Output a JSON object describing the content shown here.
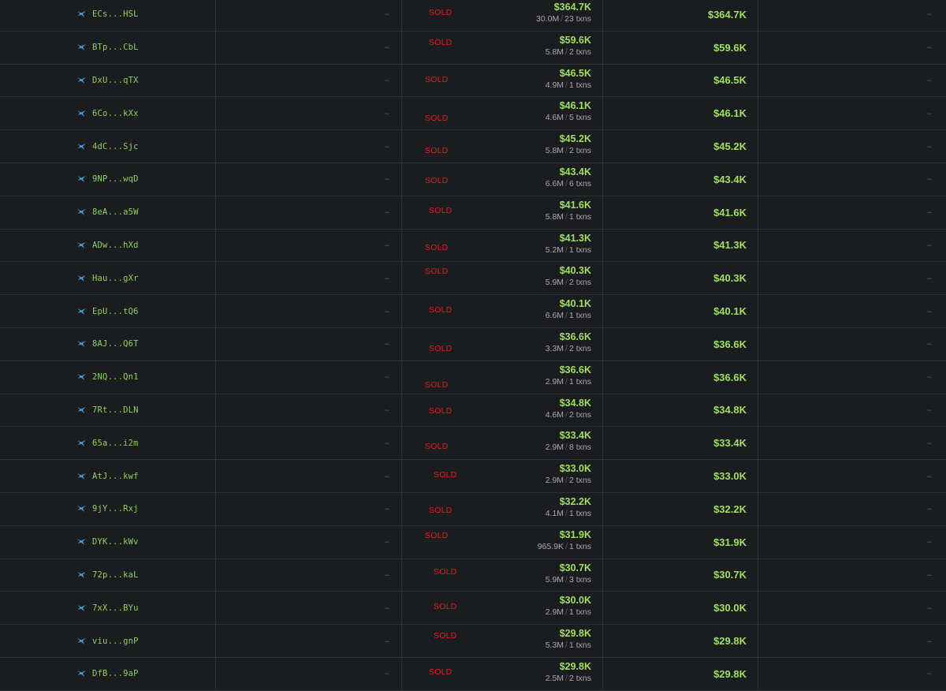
{
  "placeholder_dash": "–",
  "sold_label": "SOLD",
  "txns_suffix": "txns",
  "colors": {
    "background": "#1b1c20",
    "address": "#8dd25c",
    "usd_green": "#9fe061",
    "sold_red": "#e0211f",
    "muted": "#5b5c63",
    "whale_icon": "#4aa3df"
  },
  "rows": [
    {
      "maker": "ECs...HSL",
      "sold_usd": "$364.7K",
      "sold_tokens": "30.0M",
      "txns": "23",
      "pnl": "$364.7K"
    },
    {
      "maker": "BTp...CbL",
      "sold_usd": "$59.6K",
      "sold_tokens": "5.8M",
      "txns": "2",
      "pnl": "$59.6K"
    },
    {
      "maker": "DxU...qTX",
      "sold_usd": "$46.5K",
      "sold_tokens": "4.9M",
      "txns": "1",
      "pnl": "$46.5K"
    },
    {
      "maker": "6Co...kXx",
      "sold_usd": "$46.1K",
      "sold_tokens": "4.6M",
      "txns": "5",
      "pnl": "$46.1K"
    },
    {
      "maker": "4dC...Sjc",
      "sold_usd": "$45.2K",
      "sold_tokens": "5.8M",
      "txns": "2",
      "pnl": "$45.2K"
    },
    {
      "maker": "9NP...wqD",
      "sold_usd": "$43.4K",
      "sold_tokens": "6.6M",
      "txns": "6",
      "pnl": "$43.4K"
    },
    {
      "maker": "8eA...a5W",
      "sold_usd": "$41.6K",
      "sold_tokens": "5.8M",
      "txns": "1",
      "pnl": "$41.6K"
    },
    {
      "maker": "ADw...hXd",
      "sold_usd": "$41.3K",
      "sold_tokens": "5.2M",
      "txns": "1",
      "pnl": "$41.3K"
    },
    {
      "maker": "Hau...gXr",
      "sold_usd": "$40.3K",
      "sold_tokens": "5.9M",
      "txns": "2",
      "pnl": "$40.3K"
    },
    {
      "maker": "EpU...tQ6",
      "sold_usd": "$40.1K",
      "sold_tokens": "6.6M",
      "txns": "1",
      "pnl": "$40.1K"
    },
    {
      "maker": "8AJ...Q6T",
      "sold_usd": "$36.6K",
      "sold_tokens": "3.3M",
      "txns": "2",
      "pnl": "$36.6K"
    },
    {
      "maker": "2NQ...Qn1",
      "sold_usd": "$36.6K",
      "sold_tokens": "2.9M",
      "txns": "1",
      "pnl": "$36.6K"
    },
    {
      "maker": "7Rt...DLN",
      "sold_usd": "$34.8K",
      "sold_tokens": "4.6M",
      "txns": "2",
      "pnl": "$34.8K"
    },
    {
      "maker": "65a...i2m",
      "sold_usd": "$33.4K",
      "sold_tokens": "2.9M",
      "txns": "8",
      "pnl": "$33.4K"
    },
    {
      "maker": "AtJ...kwf",
      "sold_usd": "$33.0K",
      "sold_tokens": "2.9M",
      "txns": "2",
      "pnl": "$33.0K"
    },
    {
      "maker": "9jY...Rxj",
      "sold_usd": "$32.2K",
      "sold_tokens": "4.1M",
      "txns": "1",
      "pnl": "$32.2K"
    },
    {
      "maker": "DYK...kWv",
      "sold_usd": "$31.9K",
      "sold_tokens": "965.9K",
      "txns": "1",
      "pnl": "$31.9K"
    },
    {
      "maker": "72p...kaL",
      "sold_usd": "$30.7K",
      "sold_tokens": "5.9M",
      "txns": "3",
      "pnl": "$30.7K"
    },
    {
      "maker": "7xX...BYu",
      "sold_usd": "$30.0K",
      "sold_tokens": "2.9M",
      "txns": "1",
      "pnl": "$30.0K"
    },
    {
      "maker": "viu...gnP",
      "sold_usd": "$29.8K",
      "sold_tokens": "5.3M",
      "txns": "1",
      "pnl": "$29.8K"
    },
    {
      "maker": "DfB...9aP",
      "sold_usd": "$29.8K",
      "sold_tokens": "2.5M",
      "txns": "2",
      "pnl": "$29.8K"
    }
  ]
}
